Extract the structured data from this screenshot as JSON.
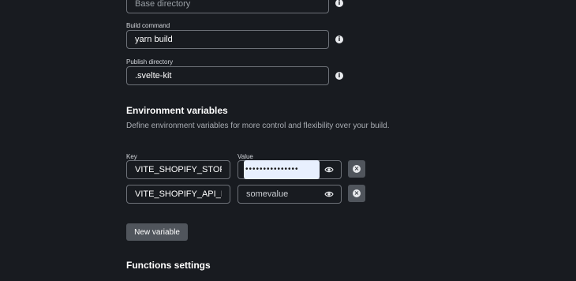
{
  "base_directory": {
    "placeholder": "Base directory"
  },
  "build_command": {
    "label": "Build command",
    "value": "yarn build"
  },
  "publish_directory": {
    "label": "Publish directory",
    "value": ".svelte-kit"
  },
  "env": {
    "heading": "Environment variables",
    "description": "Define environment variables for more control and flexibility over your build.",
    "key_label": "Key",
    "value_label": "Value",
    "rows": [
      {
        "key": "VITE_SHOPIFY_STOREFRONT",
        "value_masked": "•••••••••••••••"
      },
      {
        "key": "VITE_SHOPIFY_API_ENDPOINT",
        "value": "somevalue"
      }
    ],
    "new_variable_label": "New variable"
  },
  "functions": {
    "heading": "Functions settings"
  },
  "icons": {
    "info": "info-icon",
    "eye": "eye-icon",
    "remove": "close-circle-icon"
  }
}
